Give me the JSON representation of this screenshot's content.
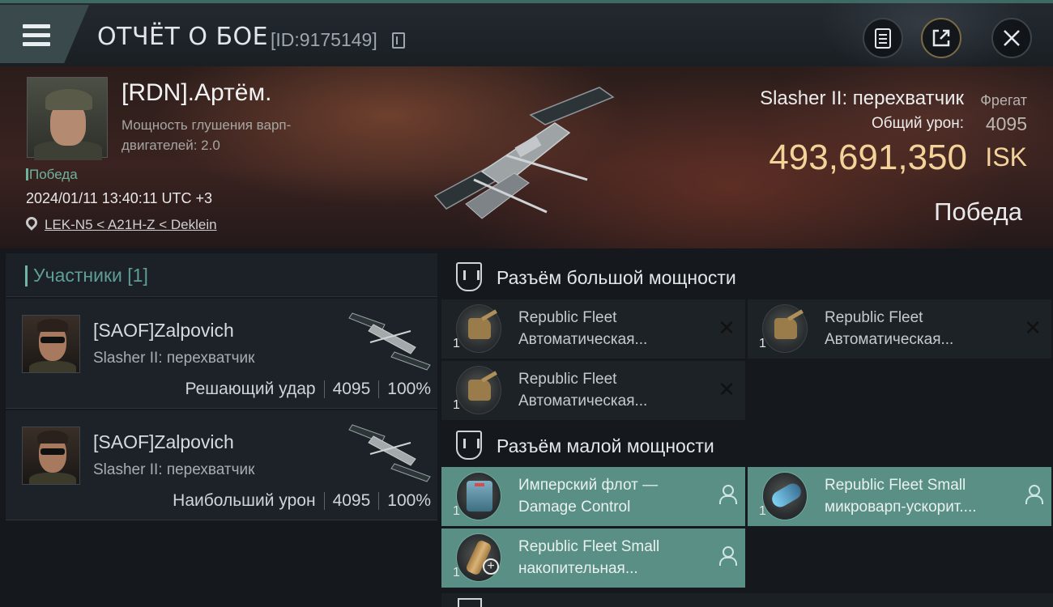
{
  "header": {
    "title": "ОТЧЁТ О БОЕ",
    "report_id": "[ID:9175149]",
    "icons": [
      "menu-icon",
      "copy-icon",
      "clipboard-icon",
      "share-icon",
      "close-icon"
    ]
  },
  "victim": {
    "name": "[RDN].Артём.",
    "attribute": "Мощность глушения варп-двигателей: 2.0",
    "result_small": "Победа",
    "datetime": "2024/01/11 13:40:11 UTC +3",
    "location": "LEK-N5 < A21H-Z < Deklein",
    "ship": "Slasher II: перехватчик",
    "ship_class": "Фрегат",
    "damage_label": "Общий урон:",
    "damage_value": "4095",
    "isk_value": "493,691,350",
    "isk_unit": "ISK",
    "result_big": "Победа"
  },
  "participants": {
    "header": "Участники [1]",
    "items": [
      {
        "name": "[SAOF]Zalpovich",
        "ship": "Slasher II: перехватчик",
        "role": "Решающий удар",
        "damage": "4095",
        "percent": "100%"
      },
      {
        "name": "[SAOF]Zalpovich",
        "ship": "Slasher II: перехватчик",
        "role": "Наибольший урон",
        "damage": "4095",
        "percent": "100%"
      }
    ]
  },
  "sections": {
    "high": {
      "title": "Разъём большой мощности",
      "modules": [
        {
          "line1": "Republic Fleet",
          "line2": "Автоматическая...",
          "qty": "1",
          "status": "destroyed"
        },
        {
          "line1": "Republic Fleet",
          "line2": "Автоматическая...",
          "qty": "1",
          "status": "destroyed"
        },
        {
          "line1": "Republic Fleet",
          "line2": "Автоматическая...",
          "qty": "1",
          "status": "destroyed"
        }
      ]
    },
    "low": {
      "title": "Разъём малой мощности",
      "modules": [
        {
          "line1": "Имперский флот —",
          "line2": "Damage Control",
          "qty": "1",
          "status": "dropped"
        },
        {
          "line1": "Republic Fleet Small",
          "line2": "микроварп-ускорит....",
          "qty": "1",
          "status": "dropped"
        },
        {
          "line1": "Republic Fleet Small",
          "line2": "накопительная...",
          "qty": "1",
          "status": "dropped"
        }
      ]
    }
  },
  "colors": {
    "accent_teal": "#5a8f85",
    "isk_gold": "#f3d39a",
    "victory_green": "#6fb39c"
  }
}
